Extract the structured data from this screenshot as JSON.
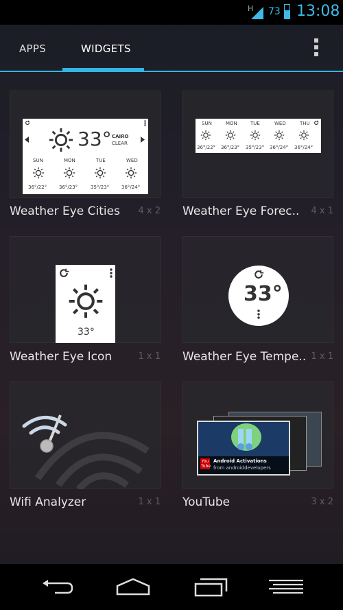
{
  "status_bar": {
    "network": "H",
    "battery_percent": "73",
    "time": "13:08"
  },
  "tabs": [
    {
      "label": "APPS",
      "selected": false
    },
    {
      "label": "WIDGETS",
      "selected": true
    }
  ],
  "accent_color": "#33b5e5",
  "widgets": [
    {
      "name": "Weather Eye Cities",
      "size": "4 x 2",
      "preview": {
        "temp": "33°",
        "city": "CAIRO",
        "condition": "CLEAR",
        "days": [
          "SUN",
          "MON",
          "TUE",
          "WED"
        ],
        "ranges": [
          "36°/22°",
          "36°/23°",
          "35°/23°",
          "36°/24°"
        ]
      }
    },
    {
      "name": "Weather Eye Forec..",
      "size": "4 x 1",
      "preview": {
        "days": [
          "SUN",
          "MON",
          "TUE",
          "WED",
          "THU"
        ],
        "ranges": [
          "36°/22°",
          "36°/23°",
          "35°/23°",
          "36°/24°",
          "36°/24°"
        ]
      }
    },
    {
      "name": "Weather Eye Icon",
      "size": "1 x 1",
      "preview": {
        "temp": "33°"
      }
    },
    {
      "name": "Weather Eye Tempe..",
      "size": "1 x 1",
      "preview": {
        "temp": "33°"
      }
    },
    {
      "name": "Wifi Analyzer",
      "size": "1 x 1"
    },
    {
      "name": "YouTube",
      "size": "3 x 2",
      "preview": {
        "title": "Android Activations",
        "subtitle": "from androiddevelopers",
        "logo": "You Tube"
      }
    }
  ],
  "nav_bar": {
    "icons": [
      "back-icon",
      "home-icon",
      "recent-apps-icon",
      "menu-icon"
    ]
  }
}
